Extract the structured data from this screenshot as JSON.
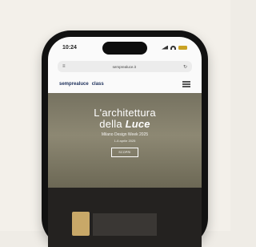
{
  "status_bar": {
    "time": "10:24"
  },
  "browser": {
    "url": "semprealuce.it"
  },
  "site": {
    "logo": [
      "semprealuce",
      "class"
    ]
  },
  "hero": {
    "title_line1": "L'architettura",
    "title_line2_plain": "della ",
    "title_line2_emphasis": "Luce",
    "subtitle": "Milano Design Week 2025",
    "date": "1-6 aprile 2025",
    "button_label": "SCOPRI"
  },
  "colors": {
    "battery": "#c9a224",
    "hero_overlay": "#7d7866",
    "logo": "#1c2f5a"
  }
}
